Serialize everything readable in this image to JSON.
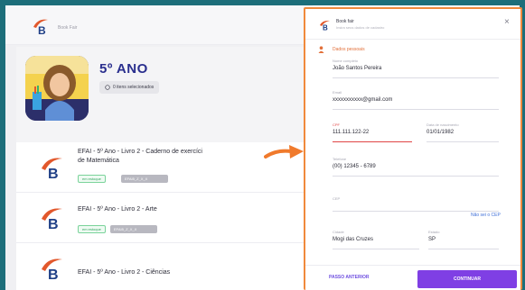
{
  "app": {
    "brand_small": "Book Fair"
  },
  "hero": {
    "grade_title": "5º ANO",
    "selected_chip": "0 itens selecionados"
  },
  "books": [
    {
      "title_line1": "EFAI - 5º Ano - Livro 2 - Caderno de exercíci",
      "title_line2": "de Matemática",
      "status": "em estoque",
      "code": "EFAI5_Z_X_X"
    },
    {
      "title_line1": "EFAI - 5º Ano - Livro 2 - Arte",
      "title_line2": "",
      "status": "em estoque",
      "code": "EFAI5_Z_X_X"
    },
    {
      "title_line1": "EFAI - 5º Ano - Livro 2 - Ciências",
      "title_line2": "",
      "status": "",
      "code": ""
    }
  ],
  "panel": {
    "title": "Book fair",
    "subtitle": "Insira seus dados de cadastro",
    "close_glyph": "×",
    "section": "Dados pessoais",
    "fields": {
      "name_label": "Nome completo",
      "name_value": "João Santos Pereira",
      "email_label": "Email",
      "email_value": "xxxxxxxxxxx@gmail.com",
      "cpf_label": "CPF",
      "cpf_value": "111.111.122-22",
      "birth_label": "Data de nascimento",
      "birth_value": "01/01/1982",
      "phone_label": "Telefone",
      "phone_value": "(00) 12345 - 6789",
      "cep_label": "CEP",
      "cep_link": "Não sei o CEP",
      "city_label": "Cidade",
      "city_value": "Mogi das Cruzes",
      "state_label": "Estado",
      "state_value": "SP"
    },
    "back_button": "PASSO ANTERIOR",
    "next_button": "CONTINUAR"
  },
  "colors": {
    "background": "#1d6e7a",
    "accent_orange": "#f08a3c",
    "primary_purple": "#7f3fe4",
    "grade_blue": "#2a2f8e"
  }
}
